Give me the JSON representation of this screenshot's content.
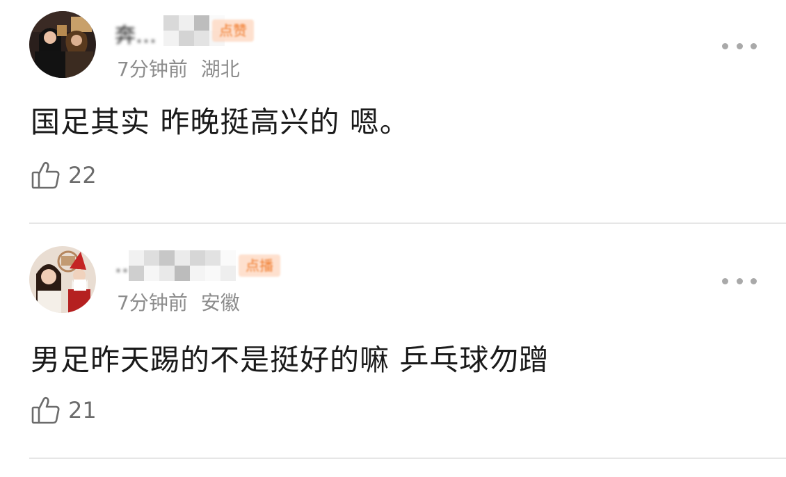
{
  "comments": [
    {
      "user_name": "奔…",
      "badge": "点赞",
      "time": "7分钟前",
      "location": "湖北",
      "text": "国足其实  昨晚挺高兴的  嗯。",
      "likes": "22",
      "avatar_icon": "user-avatar"
    },
    {
      "user_name": "…",
      "badge": "点播",
      "time": "7分钟前",
      "location": "安徽",
      "text": "男足昨天踢的不是挺好的嘛 乒乓球勿蹭",
      "likes": "21",
      "avatar_icon": "user-avatar"
    }
  ],
  "icons": {
    "like": "thumbs-up-icon",
    "more": "more-dots-icon"
  },
  "colors": {
    "text": "#1a1a1a",
    "meta": "#8c8c8c",
    "badge": "#f07a2a",
    "divider": "#e6e6e6"
  }
}
